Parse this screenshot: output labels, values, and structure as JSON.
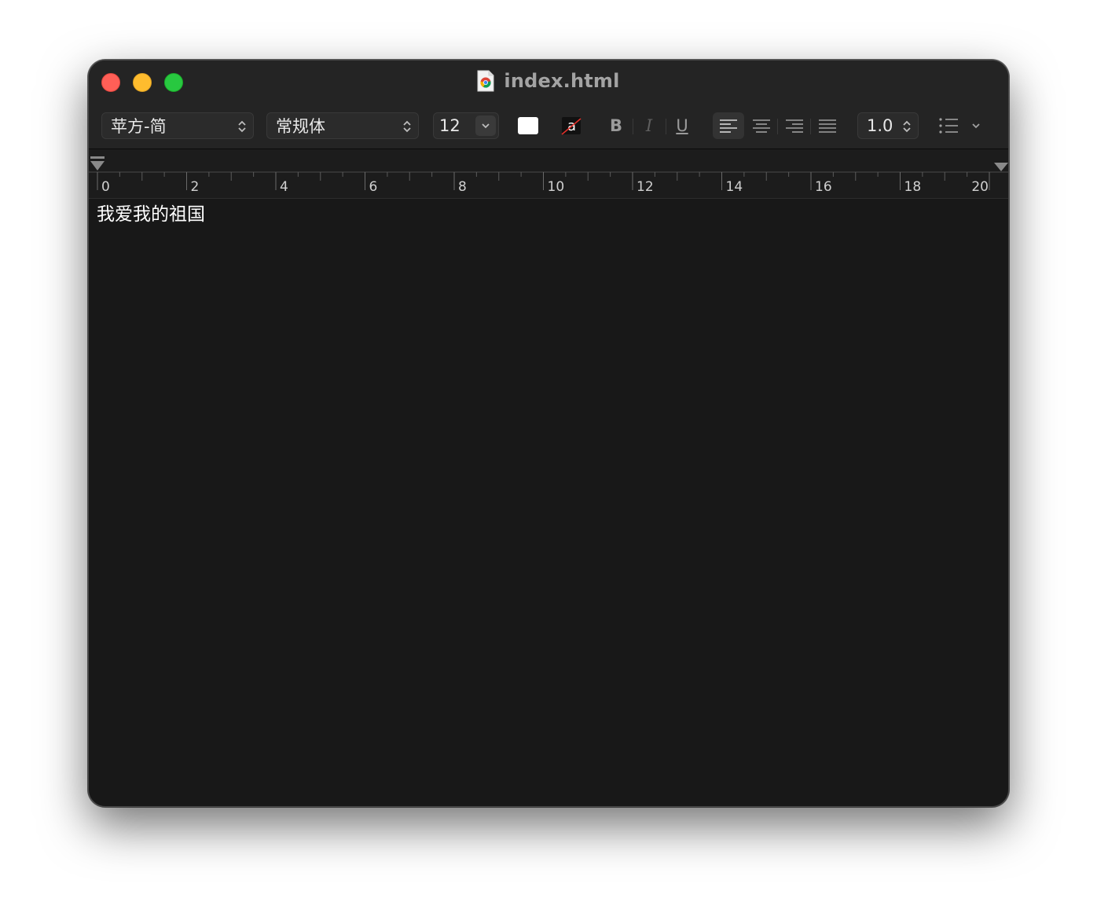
{
  "window": {
    "title": "index.html",
    "file_icon": "chrome-html-file-icon"
  },
  "toolbar": {
    "font_family": "苹方-简",
    "font_style": "常规体",
    "font_size": "12",
    "text_color": "#ffffff",
    "bold_label": "B",
    "italic_label": "I",
    "underline_label": "U",
    "alignment_active": "left",
    "line_spacing": "1.0"
  },
  "ruler": {
    "labels": [
      "0",
      "2",
      "4",
      "6",
      "8",
      "10",
      "12",
      "14",
      "16",
      "18",
      "20"
    ]
  },
  "document": {
    "text": "我爱我的祖国"
  },
  "colors": {
    "background": "#181818",
    "titlebar": "#242424",
    "close": "#ff5f57",
    "minimize": "#febc2e",
    "zoom": "#28c840"
  }
}
